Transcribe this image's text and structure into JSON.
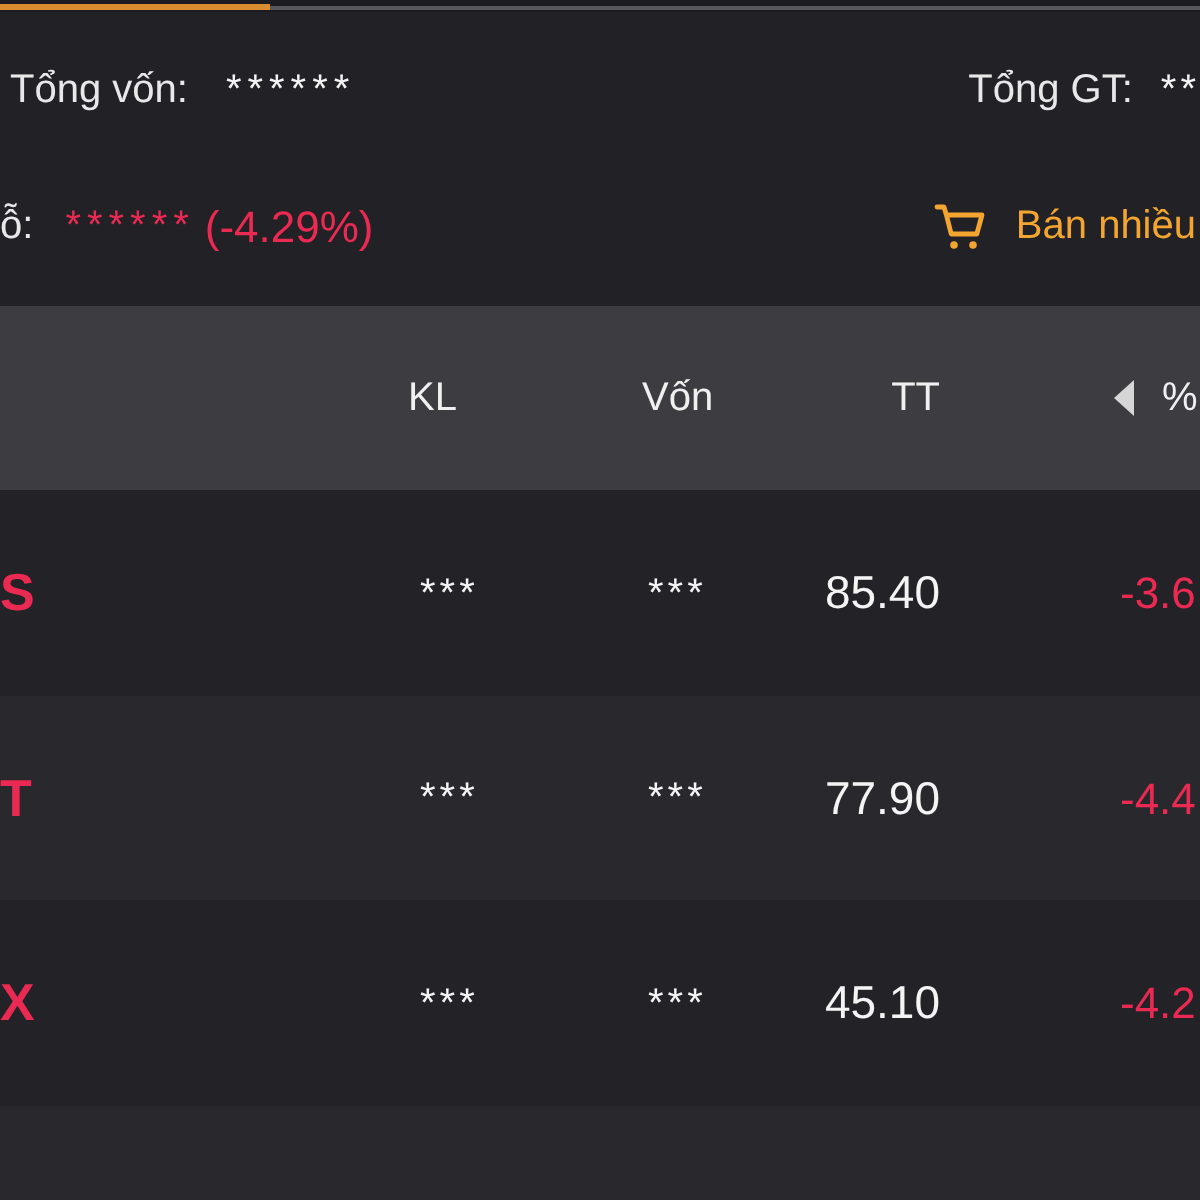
{
  "tabs": [
    {
      "selected": true
    },
    {
      "selected": false
    }
  ],
  "summary": {
    "total_capital": {
      "label": "Tổng vốn:",
      "value": "******"
    },
    "total_value": {
      "label": "Tổng GT:",
      "value": "**"
    },
    "profit_loss": {
      "label": "ỗ:",
      "value": "******",
      "change": "(-4.29%)",
      "loss": true
    },
    "sell_many_button": {
      "label": "Bán nhiều"
    }
  },
  "table": {
    "columns": [
      "KL",
      "Vốn",
      "TT",
      "%"
    ],
    "rows": [
      {
        "symbol": "S",
        "volume": "***",
        "capital": "***",
        "price": "85.40",
        "change": "-3.6",
        "loss": true
      },
      {
        "symbol": "T",
        "volume": "***",
        "capital": "***",
        "price": "77.90",
        "change": "-4.4",
        "loss": true
      },
      {
        "symbol": "X",
        "volume": "***",
        "capital": "***",
        "price": "45.10",
        "change": "-4.2",
        "loss": true
      }
    ]
  }
}
